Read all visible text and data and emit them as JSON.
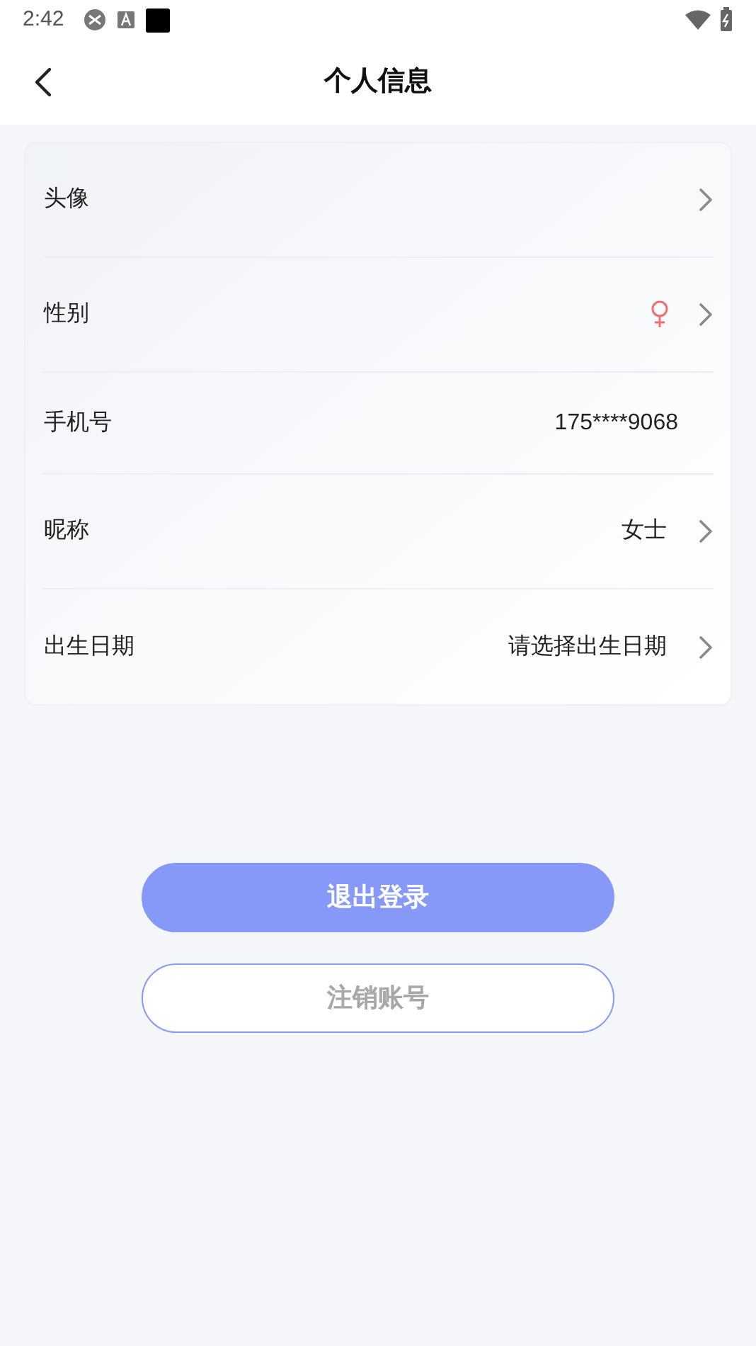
{
  "status_bar": {
    "time": "2:42"
  },
  "header": {
    "title": "个人信息"
  },
  "rows": [
    {
      "kind": "arrow",
      "label": "头像"
    },
    {
      "kind": "gender",
      "label": "性别"
    },
    {
      "kind": "value",
      "label": "手机号",
      "value": "175****9068"
    },
    {
      "kind": "value-arrow",
      "label": "昵称",
      "value": "女士"
    },
    {
      "kind": "value-arrow",
      "label": "出生日期",
      "value": "请选择出生日期"
    }
  ],
  "buttons": [
    {
      "kind": "primary",
      "label": "退出登录"
    },
    {
      "kind": "outline",
      "label": "注销账号"
    }
  ]
}
